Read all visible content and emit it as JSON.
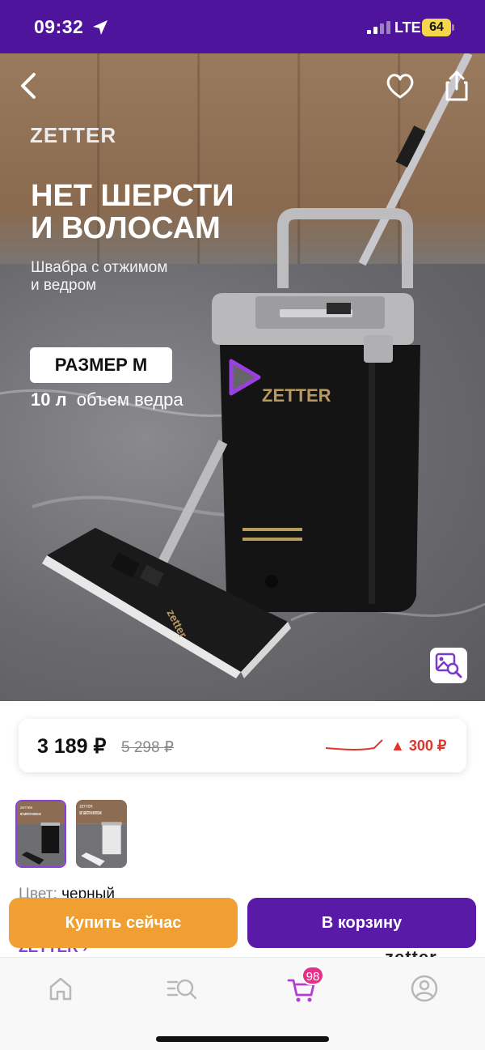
{
  "status_bar": {
    "time": "09:32",
    "network": "LTE",
    "battery": "64"
  },
  "hero": {
    "brand": "ZETTER",
    "headline_line1": "НЕТ ШЕРСТИ",
    "headline_line2": "И ВОЛОСАМ",
    "subline_line1": "Швабра с отжимом",
    "subline_line2": "и ведром",
    "size_label": "РАЗМЕР М",
    "volume_value": "10 л",
    "volume_text": "объем ведра",
    "bucket_brand": "ZETTER",
    "mop_brand": "zetter"
  },
  "price": {
    "current": "3 189 ₽",
    "old": "5 298 ₽",
    "change": "300 ₽",
    "change_direction": "up",
    "accent_color": "#e0352b"
  },
  "thumbnails": [
    {
      "variant": "черный",
      "brand": "ZETTER",
      "headline": "НЕТ ШЕРСТИ И ВОЛОСАМ",
      "selected": true
    },
    {
      "variant": "серый",
      "brand": "ZETTER",
      "headline": "НЕТ ШЕРСТИ И ВОЛОСАМ",
      "selected": false
    }
  ],
  "details": {
    "color_label": "Цвет:",
    "color_value": "черный",
    "brand_link": "ZETTER ›",
    "brand_logo": "zetter"
  },
  "actions": {
    "buy_now": "Купить сейчас",
    "add_to_cart": "В корзину",
    "buy_color": "#f0a033",
    "cart_color": "#5a1aa8"
  },
  "tab_bar": {
    "items": [
      {
        "icon": "home-icon",
        "active": false
      },
      {
        "icon": "catalog-search-icon",
        "active": false
      },
      {
        "icon": "cart-icon",
        "active": true
      },
      {
        "icon": "profile-icon",
        "active": false
      }
    ],
    "cart_count": "98",
    "active_color": "#b43cd6"
  },
  "icons": {
    "back": "chevron-left-icon",
    "favorite": "heart-icon",
    "share": "share-icon",
    "play": "play-icon",
    "zoom": "image-search-icon"
  }
}
